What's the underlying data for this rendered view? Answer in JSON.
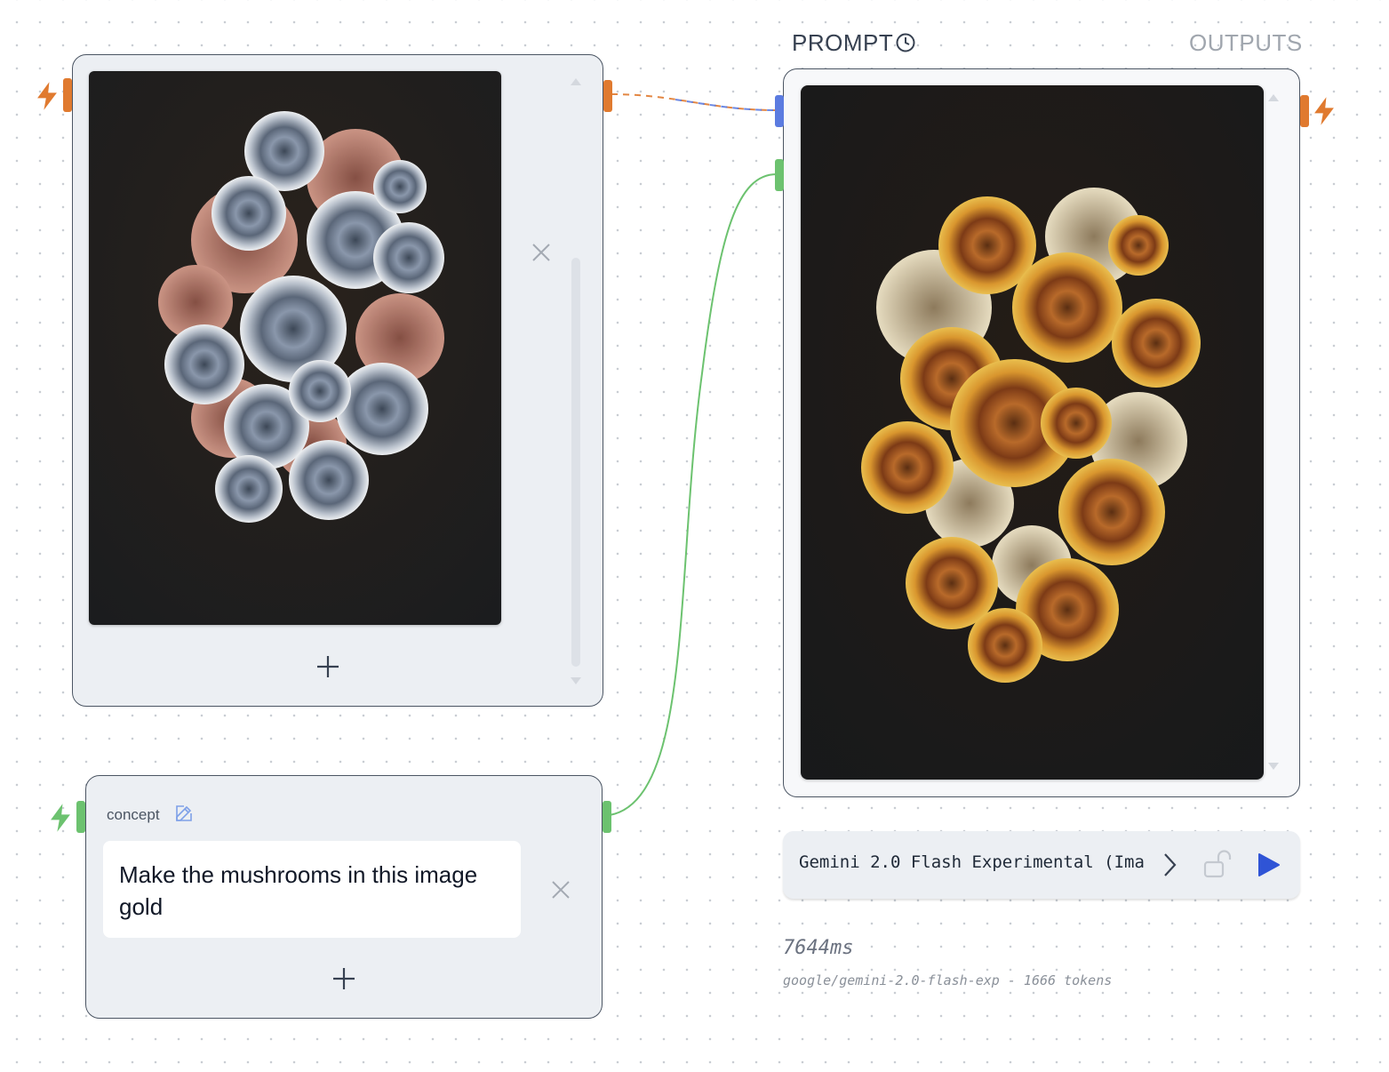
{
  "prompt_node": {
    "tab_prompt": "PROMPT",
    "tab_outputs": "OUTPUTS"
  },
  "concept_node": {
    "label": "concept",
    "text": "Make the mushrooms in this image gold"
  },
  "model_bar": {
    "model_name": "Gemini 2.0 Flash Experimental (Ima"
  },
  "result": {
    "latency": "7644ms",
    "meta": "google/gemini-2.0-flash-exp - 1666 tokens"
  },
  "images": {
    "input_image": "mushroom collage artwork: blue-grey turkey tail fungi and pink gill mushrooms on dark background",
    "output_image": "mushroom collage artwork recoloured gold on dark background"
  },
  "colors": {
    "accent_orange": "#e07a2f",
    "accent_green": "#6cc26f",
    "accent_blue": "#5b7be0",
    "play_blue": "#2f54d6"
  }
}
